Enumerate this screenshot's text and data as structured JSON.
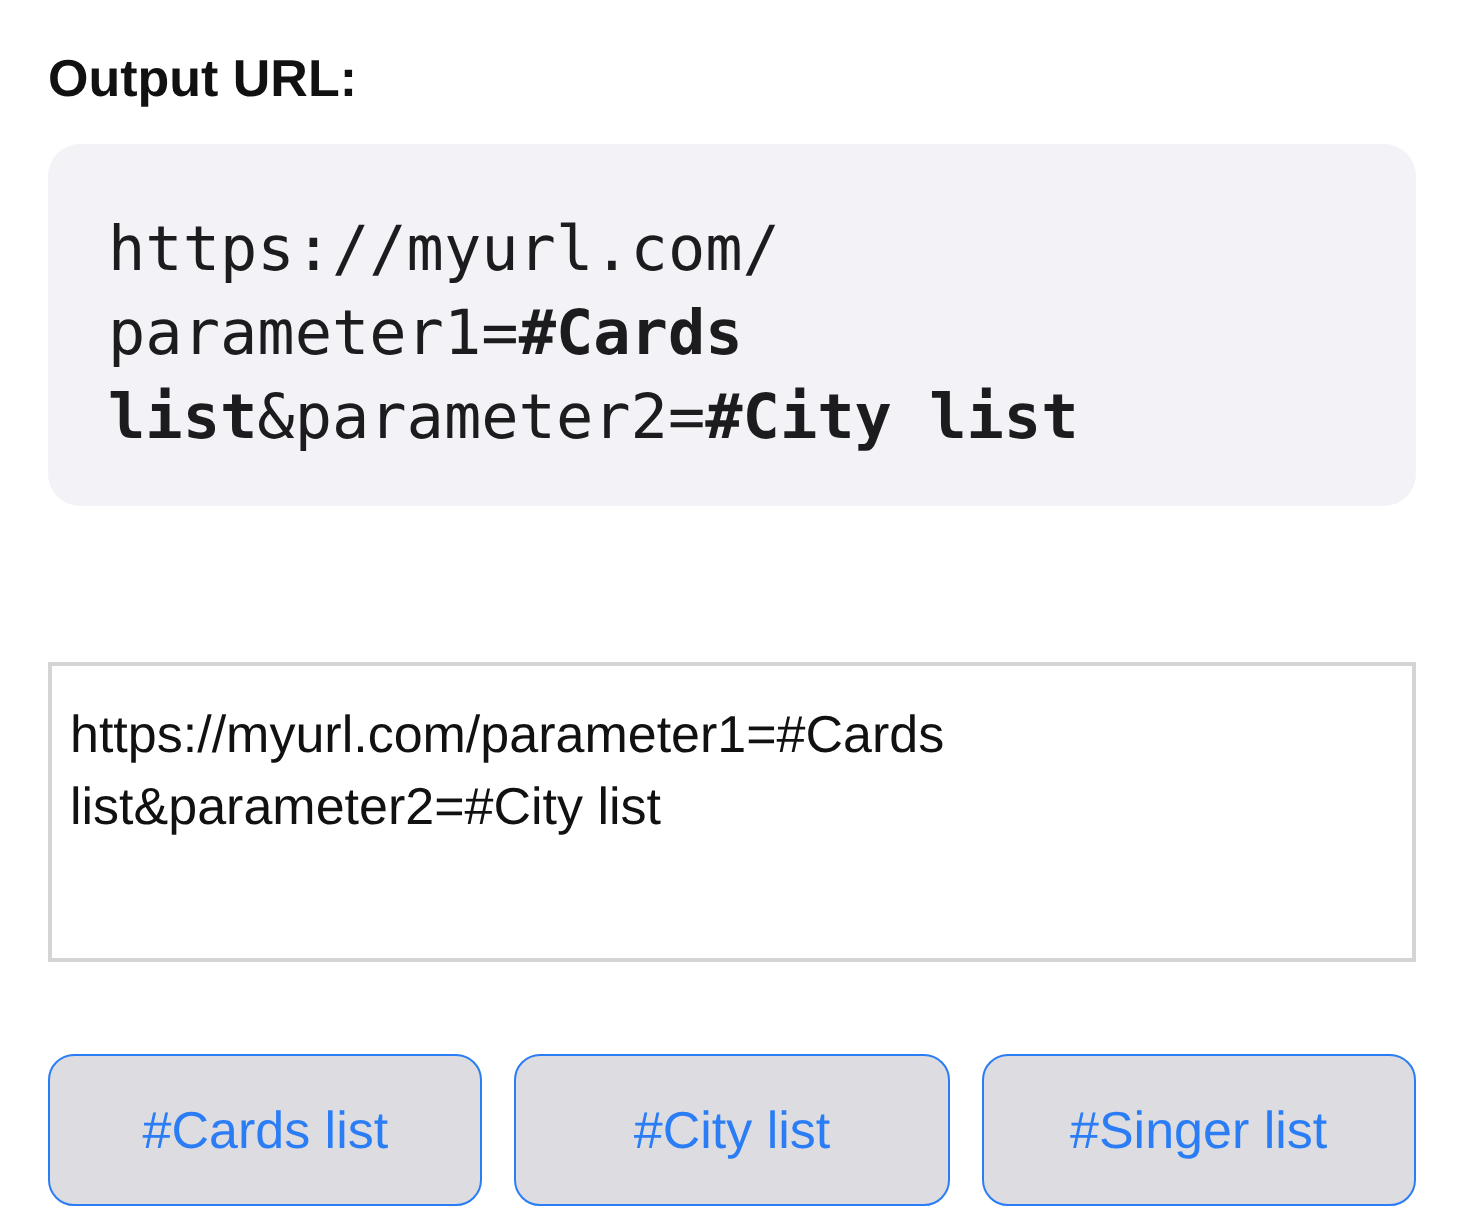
{
  "title": "Output URL:",
  "output_lines": [
    "https://myurl.com/",
    "parameter1=**#Cards**",
    "**list**&parameter2=**#City list**"
  ],
  "text_area": {
    "value": "https://myurl.com/parameter1=#Cards list&parameter2=#City list"
  },
  "buttons": [
    "#Cards list",
    "#City list",
    "#Singer list"
  ]
}
